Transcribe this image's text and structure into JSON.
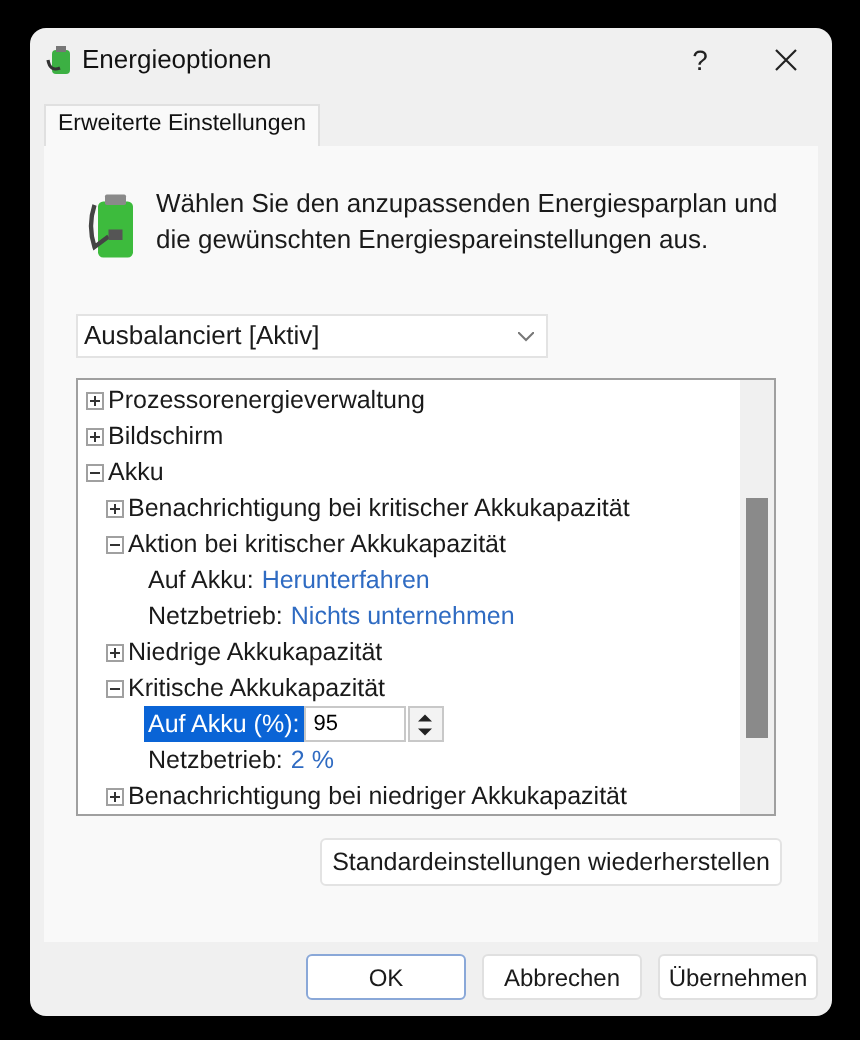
{
  "window": {
    "title": "Energieoptionen",
    "help": "?"
  },
  "tabs": [
    {
      "label": "Erweiterte Einstellungen",
      "selected": true
    }
  ],
  "intro": "Wählen Sie den anzupassenden Energiesparplan und die gewünschten Energiespareinstellungen aus.",
  "plan_select": {
    "value": "Ausbalanciert [Aktiv]"
  },
  "tree": [
    {
      "kind": "group",
      "label": "Prozessorenergieverwaltung",
      "expanded": false
    },
    {
      "kind": "group",
      "label": "Bildschirm",
      "expanded": false
    },
    {
      "kind": "group",
      "label": "Akku",
      "expanded": true,
      "children": [
        {
          "kind": "group",
          "label": "Benachrichtigung bei kritischer Akkukapazität",
          "expanded": false
        },
        {
          "kind": "group",
          "label": "Aktion bei kritischer Akkukapazität",
          "expanded": true,
          "children": [
            {
              "kind": "setting",
              "label": "Auf Akku:",
              "value": "Herunterfahren"
            },
            {
              "kind": "setting",
              "label": "Netzbetrieb:",
              "value": "Nichts unternehmen"
            }
          ]
        },
        {
          "kind": "group",
          "label": "Niedrige Akkukapazität",
          "expanded": false
        },
        {
          "kind": "group",
          "label": "Kritische Akkukapazität",
          "expanded": true,
          "children": [
            {
              "kind": "spin",
              "label": "Auf Akku (%):",
              "value": "95",
              "selected": true
            },
            {
              "kind": "setting",
              "label": "Netzbetrieb:",
              "value": "2 %"
            }
          ]
        },
        {
          "kind": "group",
          "label": "Benachrichtigung bei niedriger Akkukapazität",
          "expanded": false
        }
      ]
    }
  ],
  "restore_button": "Standardeinstellungen wiederherstellen",
  "buttons": [
    {
      "label": "OK",
      "default": true
    },
    {
      "label": "Abbrechen",
      "default": false
    },
    {
      "label": "Übernehmen",
      "default": false
    }
  ]
}
